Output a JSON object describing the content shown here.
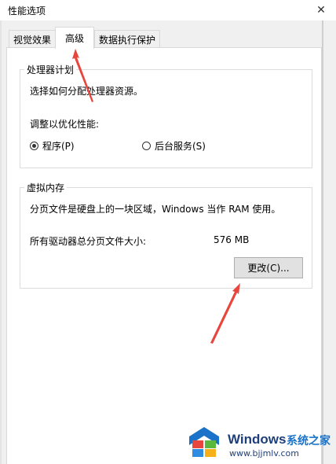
{
  "window": {
    "title": "性能选项",
    "close_glyph": "✕"
  },
  "tabs": [
    {
      "label": "视觉效果",
      "active": false
    },
    {
      "label": "高级",
      "active": true
    },
    {
      "label": "数据执行保护",
      "active": false
    }
  ],
  "processor_scheduling": {
    "title": "处理器计划",
    "description": "选择如何分配处理器资源。",
    "adjust_label": "调整以优化性能:",
    "options": [
      {
        "label": "程序(P)",
        "selected": true
      },
      {
        "label": "后台服务(S)",
        "selected": false
      }
    ]
  },
  "virtual_memory": {
    "title": "虚拟内存",
    "description": "分页文件是硬盘上的一块区域，Windows 当作 RAM 使用。",
    "total_label": "所有驱动器总分页文件大小:",
    "total_value": "576 MB",
    "change_button": "更改(C)..."
  },
  "watermark": {
    "brand": "Windows",
    "tagline": "系统之家",
    "url": "www.bjjmlv.com"
  },
  "colors": {
    "annotation_arrow": "#e8453c",
    "watermark_blue": "#1a73c9",
    "watermark_text": "#1f3f7a"
  }
}
